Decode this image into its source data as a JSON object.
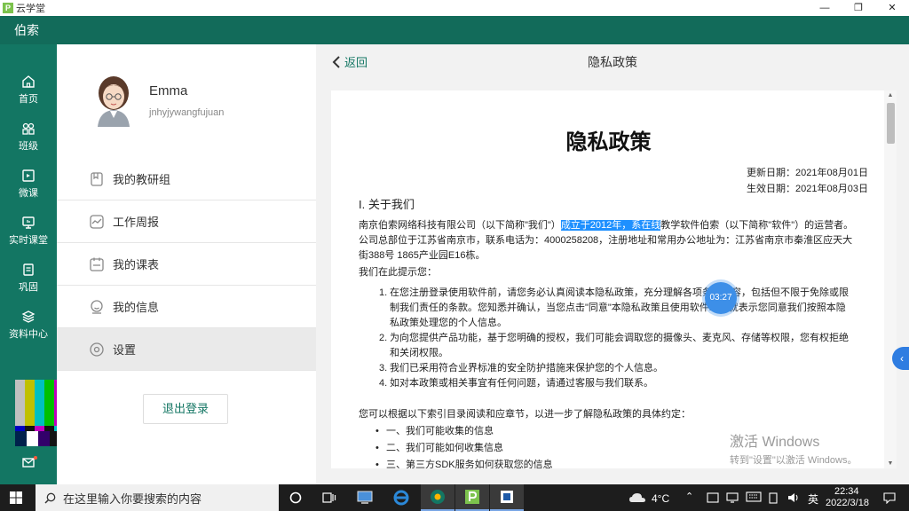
{
  "window": {
    "app_title": "云学堂",
    "app_icon_letter": "P",
    "minimize_label": "—",
    "maximize_label": "❐",
    "close_label": "✕"
  },
  "header": {
    "title": "伯索"
  },
  "nav": {
    "items": [
      {
        "label": "首页",
        "icon": "home-icon"
      },
      {
        "label": "班级",
        "icon": "class-icon"
      },
      {
        "label": "微课",
        "icon": "microlesson-icon"
      },
      {
        "label": "实时课堂",
        "icon": "live-classroom-icon"
      },
      {
        "label": "巩固",
        "icon": "consolidate-icon"
      },
      {
        "label": "资料中心",
        "icon": "materials-icon"
      }
    ]
  },
  "profile": {
    "name": "Emma",
    "username": "jnhyjywangfujuan",
    "menu": [
      {
        "label": "我的教研组",
        "icon": "teaching-group-icon"
      },
      {
        "label": "工作周报",
        "icon": "weekly-report-icon"
      },
      {
        "label": "我的课表",
        "icon": "schedule-icon"
      },
      {
        "label": "我的信息",
        "icon": "my-info-icon"
      },
      {
        "label": "设置",
        "icon": "settings-icon",
        "active": true
      }
    ],
    "logout_label": "退出登录"
  },
  "content": {
    "back_label": "返回",
    "page_title": "隐私政策",
    "doc": {
      "title": "隐私政策",
      "updated": "更新日期：2021年08月01日",
      "effective": "生效日期：2021年08月03日",
      "section1_heading": "I. 关于我们",
      "p1_before": "南京伯索网络科技有限公司（以下简称\"我们\"）",
      "p1_highlight": "成立于2012年，系在线",
      "p1_after": "教学软件伯索（以下简称\"软件\"）的运营者。公司总部位于江苏省南京市，联系电话为：4000258208，注册地址和常用办公地址为：江苏省南京市秦淮区应天大街388号 1865产业园E16栋。",
      "p2": "我们在此提示您：",
      "list": [
        {
          "num": "1.",
          "text": "在您注册登录使用软件前，请您务必认真阅读本隐私政策，充分理解各项条款内容，包括但不限于免除或限制我们责任的条款。您知悉并确认，当您点击\"同意\"本隐私政策且使用软件时，就表示您同意我们按照本隐私政策处理您的个人信息。"
        },
        {
          "num": "2.",
          "text": "为向您提供产品功能，基于您明确的授权，我们可能会调取您的摄像头、麦克风、存储等权限，您有权拒绝和关闭权限。"
        },
        {
          "num": "3.",
          "text": "我们已采用符合业界标准的安全防护措施来保护您的个人信息。"
        },
        {
          "num": "4.",
          "text": "如对本政策或相关事宜有任何问题，请通过客服与我们联系。"
        }
      ],
      "p3": "您可以根据以下索引目录阅读和应章节，以进一步了解隐私政策的具体约定：",
      "bullets": [
        "一、我们可能收集的信息",
        "二、我们可能如何收集信息",
        "三、第三方SDK服务如何获取您的信息"
      ]
    },
    "timer": "03:27",
    "side_tab_label": "‹"
  },
  "watermark": {
    "line1": "激活 Windows",
    "line2": "转到\"设置\"以激活 Windows。"
  },
  "taskbar": {
    "search_placeholder": "在这里输入你要搜索的内容",
    "weather": "4°C",
    "ime": "英",
    "time": "22:34",
    "date": "2022/3/18"
  }
}
